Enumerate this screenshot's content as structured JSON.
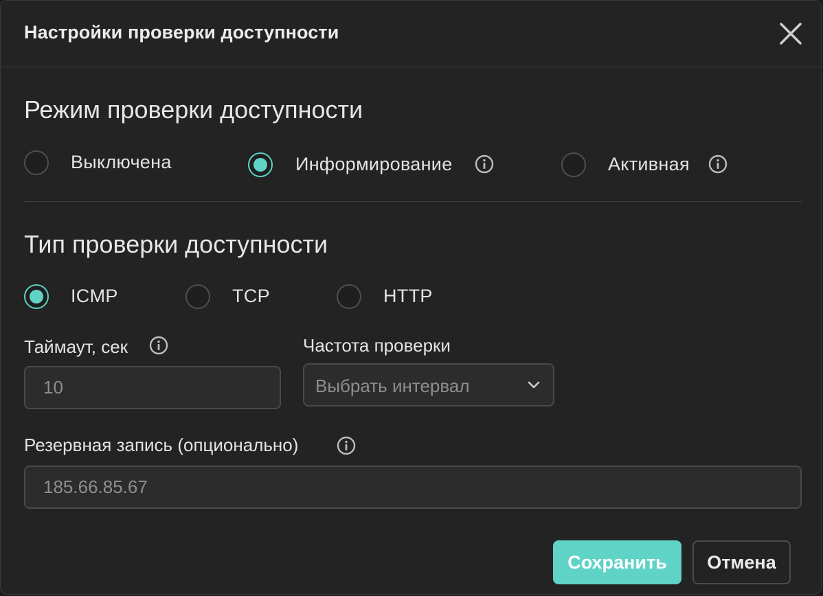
{
  "dialog": {
    "title": "Настройки проверки доступности"
  },
  "mode_section": {
    "title": "Режим проверки доступности",
    "options": [
      {
        "label": "Выключена",
        "selected": false,
        "has_info": false
      },
      {
        "label": "Информирование",
        "selected": true,
        "has_info": true
      },
      {
        "label": "Активная",
        "selected": false,
        "has_info": true
      }
    ]
  },
  "type_section": {
    "title": "Тип проверки доступности",
    "options": [
      {
        "label": "ICMP",
        "selected": true
      },
      {
        "label": "TCP",
        "selected": false
      },
      {
        "label": "HTTP",
        "selected": false
      }
    ]
  },
  "timeout": {
    "label": "Таймаут, сек",
    "value": "10"
  },
  "frequency": {
    "label": "Частота проверки",
    "placeholder": "Выбрать интервал"
  },
  "backup": {
    "label": "Резервная запись (опционально)",
    "value": "185.66.85.67"
  },
  "actions": {
    "save_label": "Сохранить",
    "cancel_label": "Отмена"
  },
  "colors": {
    "accent": "#5fd3c6",
    "background": "#232323",
    "border": "#4a4a4a"
  }
}
